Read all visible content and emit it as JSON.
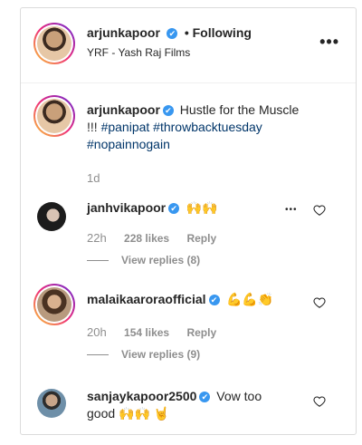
{
  "post_header": {
    "username": "arjunkapoor",
    "verified_symbol": "✔",
    "following_label": "• Following",
    "location": "YRF - Yash Raj Films",
    "more_label": "•••"
  },
  "caption": {
    "username": "arjunkapoor",
    "line1": "Hustle for the Muscle",
    "line2_plain": "!!! ",
    "tag1": "#panipat",
    "tag2": "#throwbacktuesday",
    "tag3": "#nopainnogain",
    "time": "1d"
  },
  "comments": [
    {
      "username": "janhvikapoor",
      "text": "🙌🙌",
      "time": "22h",
      "likes": "228 likes",
      "reply_label": "Reply",
      "view_replies": "View replies (8)",
      "more_label": "•••"
    },
    {
      "username": "malaikaaroraofficial",
      "text": "💪💪👏",
      "time": "20h",
      "likes": "154 likes",
      "reply_label": "Reply",
      "view_replies": "View replies (9)"
    },
    {
      "username": "sanjaykapoor2500",
      "text": "Vow too",
      "text_line2": "good",
      "text_emoji": "🙌🙌 🤘"
    }
  ],
  "icons": {
    "verified": "verified-badge-icon",
    "heart": "heart-outline-icon",
    "more": "more-options-icon"
  },
  "colors": {
    "verified_blue": "#3897f0",
    "hashtag": "#003569",
    "meta_grey": "#8e8e8e",
    "border": "#dbdbdb"
  }
}
